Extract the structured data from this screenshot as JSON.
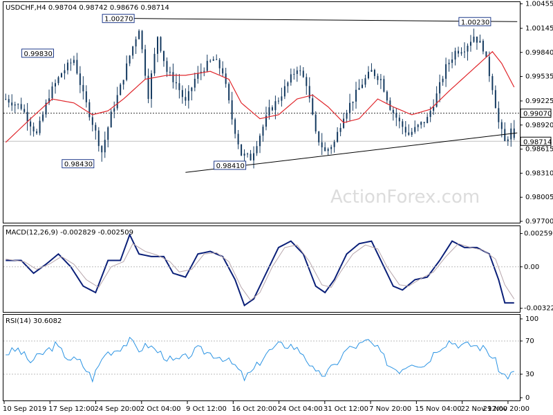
{
  "header": {
    "symbol_info": "USDCHF,H4  0.98704 0.98742 0.98676 0.98714",
    "macd_info": "MACD(12,26,9) -0.002829 -0.002509",
    "rsi_info": "RSI(14) 30.6082",
    "watermark": "ActionForex.com"
  },
  "colors": {
    "candle": "#13395f",
    "ma": "#e0262b",
    "macd_main": "#0a1f78",
    "macd_signal": "#b7a6ac",
    "rsi": "#2a93e3",
    "trendline": "#000000",
    "grid_dotted": "#bbbbbb"
  },
  "chart_data": [
    {
      "type": "candlestick",
      "panel": "price",
      "ylim": [
        0.977,
        1.0046
      ],
      "y_ticks": [
        "1.00455",
        "1.00145",
        "0.99840",
        "0.99535",
        "0.99225",
        "0.98920",
        "0.98615",
        "0.98310",
        "0.98005",
        "0.97700"
      ],
      "x_tick_labels": [
        "10 Sep 2019",
        "17 Sep 12:00",
        "24 Sep 20:00",
        "2 Oct 04:00",
        "9 Oct 12:00",
        "16 Oct 20:00",
        "24 Oct 04:00",
        "31 Oct 12:00",
        "7 Nov 20:00",
        "15 Nov 04:00",
        "22 Nov 12:00",
        "29 Nov 20:00"
      ],
      "anchor_closes": [
        [
          0,
          0.9925
        ],
        [
          5,
          0.9915
        ],
        [
          10,
          0.988
        ],
        [
          14,
          0.993
        ],
        [
          18,
          0.9958
        ],
        [
          22,
          0.9975
        ],
        [
          25,
          0.993
        ],
        [
          28,
          0.9895
        ],
        [
          31,
          0.9858
        ],
        [
          34,
          0.9905
        ],
        [
          37,
          0.994
        ],
        [
          40,
          0.998
        ],
        [
          43,
          1.0015
        ],
        [
          46,
          0.993
        ],
        [
          49,
          1.0005
        ],
        [
          52,
          0.996
        ],
        [
          55,
          0.9945
        ],
        [
          58,
          0.992
        ],
        [
          61,
          0.995
        ],
        [
          64,
          0.9965
        ],
        [
          67,
          0.9975
        ],
        [
          70,
          0.996
        ],
        [
          73,
          0.99
        ],
        [
          76,
          0.9855
        ],
        [
          79,
          0.985
        ],
        [
          82,
          0.988
        ],
        [
          85,
          0.991
        ],
        [
          88,
          0.9925
        ],
        [
          91,
          0.9945
        ],
        [
          94,
          0.9965
        ],
        [
          97,
          0.9945
        ],
        [
          100,
          0.988
        ],
        [
          103,
          0.9858
        ],
        [
          106,
          0.987
        ],
        [
          109,
          0.9905
        ],
        [
          112,
          0.9925
        ],
        [
          115,
          0.9945
        ],
        [
          118,
          0.996
        ],
        [
          121,
          0.995
        ],
        [
          124,
          0.9915
        ],
        [
          127,
          0.9895
        ],
        [
          130,
          0.988
        ],
        [
          133,
          0.989
        ],
        [
          136,
          0.99
        ],
        [
          139,
          0.993
        ],
        [
          142,
          0.9965
        ],
        [
          145,
          0.9985
        ],
        [
          148,
          0.999
        ],
        [
          151,
          1.0005
        ],
        [
          154,
          0.999
        ],
        [
          157,
          0.994
        ],
        [
          159,
          0.9895
        ],
        [
          161,
          0.987
        ],
        [
          163,
          0.9885
        ],
        [
          164,
          0.9871
        ]
      ],
      "ma_anchors": [
        [
          0,
          0.987
        ],
        [
          8,
          0.99
        ],
        [
          15,
          0.9925
        ],
        [
          22,
          0.992
        ],
        [
          28,
          0.9905
        ],
        [
          33,
          0.991
        ],
        [
          38,
          0.9925
        ],
        [
          45,
          0.995
        ],
        [
          52,
          0.9955
        ],
        [
          58,
          0.9955
        ],
        [
          66,
          0.996
        ],
        [
          72,
          0.995
        ],
        [
          76,
          0.992
        ],
        [
          82,
          0.99
        ],
        [
          88,
          0.9905
        ],
        [
          94,
          0.9925
        ],
        [
          99,
          0.993
        ],
        [
          104,
          0.9915
        ],
        [
          109,
          0.9895
        ],
        [
          114,
          0.99
        ],
        [
          120,
          0.9925
        ],
        [
          125,
          0.9915
        ],
        [
          131,
          0.9905
        ],
        [
          137,
          0.9912
        ],
        [
          143,
          0.9935
        ],
        [
          150,
          0.996
        ],
        [
          157,
          0.9985
        ],
        [
          160,
          0.997
        ],
        [
          164,
          0.994
        ]
      ],
      "annotations": [
        {
          "label": "1.00270",
          "value": 1.0027,
          "bar": 41
        },
        {
          "label": "0.99830",
          "value": 0.9983,
          "bar": 15
        },
        {
          "label": "0.98430",
          "value": 0.9843,
          "bar": 28
        },
        {
          "label": "0.98410",
          "value": 0.9841,
          "bar": 77
        },
        {
          "label": "1.00230",
          "value": 1.0023,
          "bar": 156
        }
      ],
      "trendlines": [
        {
          "from": [
            41,
            1.0027
          ],
          "to": [
            165,
            1.0023
          ]
        },
        {
          "from": [
            58,
            0.9832
          ],
          "to": [
            165,
            0.9882
          ]
        }
      ],
      "h_levels": [
        {
          "value": 0.9907,
          "label": "0.99070",
          "style": "dotted"
        },
        {
          "value": 0.98714,
          "label": "0.98714",
          "style": "solid"
        }
      ]
    },
    {
      "type": "line",
      "panel": "macd",
      "ylim": [
        -0.0034,
        0.003
      ],
      "y_ticks": [
        "0.00259",
        "0.00",
        "-0.003221"
      ],
      "series": [
        {
          "role": "main",
          "anchors": [
            [
              0,
              0.0005
            ],
            [
              5,
              0.0005
            ],
            [
              9,
              -0.0005
            ],
            [
              13,
              0.0002
            ],
            [
              17,
              0.001
            ],
            [
              21,
              0.0
            ],
            [
              25,
              -0.0015
            ],
            [
              29,
              -0.002
            ],
            [
              33,
              0.0005
            ],
            [
              37,
              0.0005
            ],
            [
              40,
              0.0025
            ],
            [
              43,
              0.001
            ],
            [
              47,
              0.0008
            ],
            [
              51,
              0.0008
            ],
            [
              54,
              -0.0005
            ],
            [
              58,
              -0.0008
            ],
            [
              62,
              0.001
            ],
            [
              66,
              0.0012
            ],
            [
              70,
              0.0008
            ],
            [
              74,
              -0.001
            ],
            [
              77,
              -0.003
            ],
            [
              80,
              -0.0025
            ],
            [
              84,
              -0.0005
            ],
            [
              88,
              0.0015
            ],
            [
              92,
              0.002
            ],
            [
              96,
              0.001
            ],
            [
              100,
              -0.0015
            ],
            [
              103,
              -0.002
            ],
            [
              106,
              -0.001
            ],
            [
              110,
              0.001
            ],
            [
              114,
              0.0018
            ],
            [
              118,
              0.002
            ],
            [
              121,
              0.0005
            ],
            [
              125,
              -0.0015
            ],
            [
              128,
              -0.0018
            ],
            [
              132,
              -0.001
            ],
            [
              136,
              -0.0008
            ],
            [
              140,
              0.0005
            ],
            [
              144,
              0.002
            ],
            [
              148,
              0.0015
            ],
            [
              152,
              0.0015
            ],
            [
              156,
              0.001
            ],
            [
              159,
              -0.001
            ],
            [
              161,
              -0.0028
            ],
            [
              164,
              -0.0028
            ]
          ]
        },
        {
          "role": "signal",
          "anchors": [
            [
              0,
              0.0006
            ],
            [
              6,
              0.0004
            ],
            [
              10,
              -0.0002
            ],
            [
              14,
              0.0002
            ],
            [
              18,
              0.0008
            ],
            [
              22,
              0.0002
            ],
            [
              26,
              -0.001
            ],
            [
              30,
              -0.0016
            ],
            [
              34,
              0.0
            ],
            [
              38,
              0.0004
            ],
            [
              41,
              0.0018
            ],
            [
              45,
              0.0012
            ],
            [
              49,
              0.0009
            ],
            [
              53,
              0.0004
            ],
            [
              56,
              -0.0004
            ],
            [
              60,
              -0.0002
            ],
            [
              64,
              0.001
            ],
            [
              68,
              0.0011
            ],
            [
              72,
              0.0004
            ],
            [
              76,
              -0.0016
            ],
            [
              79,
              -0.0026
            ],
            [
              82,
              -0.002
            ],
            [
              86,
              0.0
            ],
            [
              90,
              0.0015
            ],
            [
              94,
              0.0017
            ],
            [
              98,
              0.0004
            ],
            [
              102,
              -0.0014
            ],
            [
              105,
              -0.0016
            ],
            [
              108,
              -0.0004
            ],
            [
              112,
              0.001
            ],
            [
              116,
              0.0017
            ],
            [
              120,
              0.0014
            ],
            [
              123,
              0.0
            ],
            [
              127,
              -0.0014
            ],
            [
              130,
              -0.0015
            ],
            [
              134,
              -0.0009
            ],
            [
              138,
              -0.0004
            ],
            [
              142,
              0.0008
            ],
            [
              146,
              0.0018
            ],
            [
              150,
              0.0015
            ],
            [
              154,
              0.0013
            ],
            [
              158,
              0.0006
            ],
            [
              161,
              -0.0014
            ],
            [
              164,
              -0.0025
            ]
          ]
        }
      ]
    },
    {
      "type": "line",
      "panel": "rsi",
      "ylim": [
        0,
        100
      ],
      "y_ticks": [
        "100",
        "70",
        "30",
        "0"
      ],
      "levels": [
        70,
        30
      ],
      "series": [
        {
          "role": "rsi",
          "anchors": [
            [
              0,
              55
            ],
            [
              4,
              60
            ],
            [
              8,
              45
            ],
            [
              12,
              55
            ],
            [
              16,
              65
            ],
            [
              20,
              50
            ],
            [
              24,
              45
            ],
            [
              28,
              25
            ],
            [
              32,
              55
            ],
            [
              36,
              60
            ],
            [
              40,
              70
            ],
            [
              43,
              60
            ],
            [
              46,
              65
            ],
            [
              50,
              55
            ],
            [
              54,
              45
            ],
            [
              58,
              50
            ],
            [
              62,
              60
            ],
            [
              66,
              55
            ],
            [
              70,
              50
            ],
            [
              74,
              40
            ],
            [
              77,
              25
            ],
            [
              80,
              35
            ],
            [
              84,
              55
            ],
            [
              88,
              65
            ],
            [
              92,
              65
            ],
            [
              96,
              55
            ],
            [
              100,
              30
            ],
            [
              103,
              30
            ],
            [
              106,
              40
            ],
            [
              110,
              60
            ],
            [
              114,
              65
            ],
            [
              117,
              70
            ],
            [
              120,
              60
            ],
            [
              124,
              40
            ],
            [
              127,
              35
            ],
            [
              131,
              45
            ],
            [
              135,
              40
            ],
            [
              139,
              60
            ],
            [
              143,
              70
            ],
            [
              147,
              65
            ],
            [
              151,
              65
            ],
            [
              155,
              60
            ],
            [
              158,
              45
            ],
            [
              160,
              30
            ],
            [
              162,
              28
            ],
            [
              164,
              32
            ]
          ]
        }
      ]
    }
  ]
}
